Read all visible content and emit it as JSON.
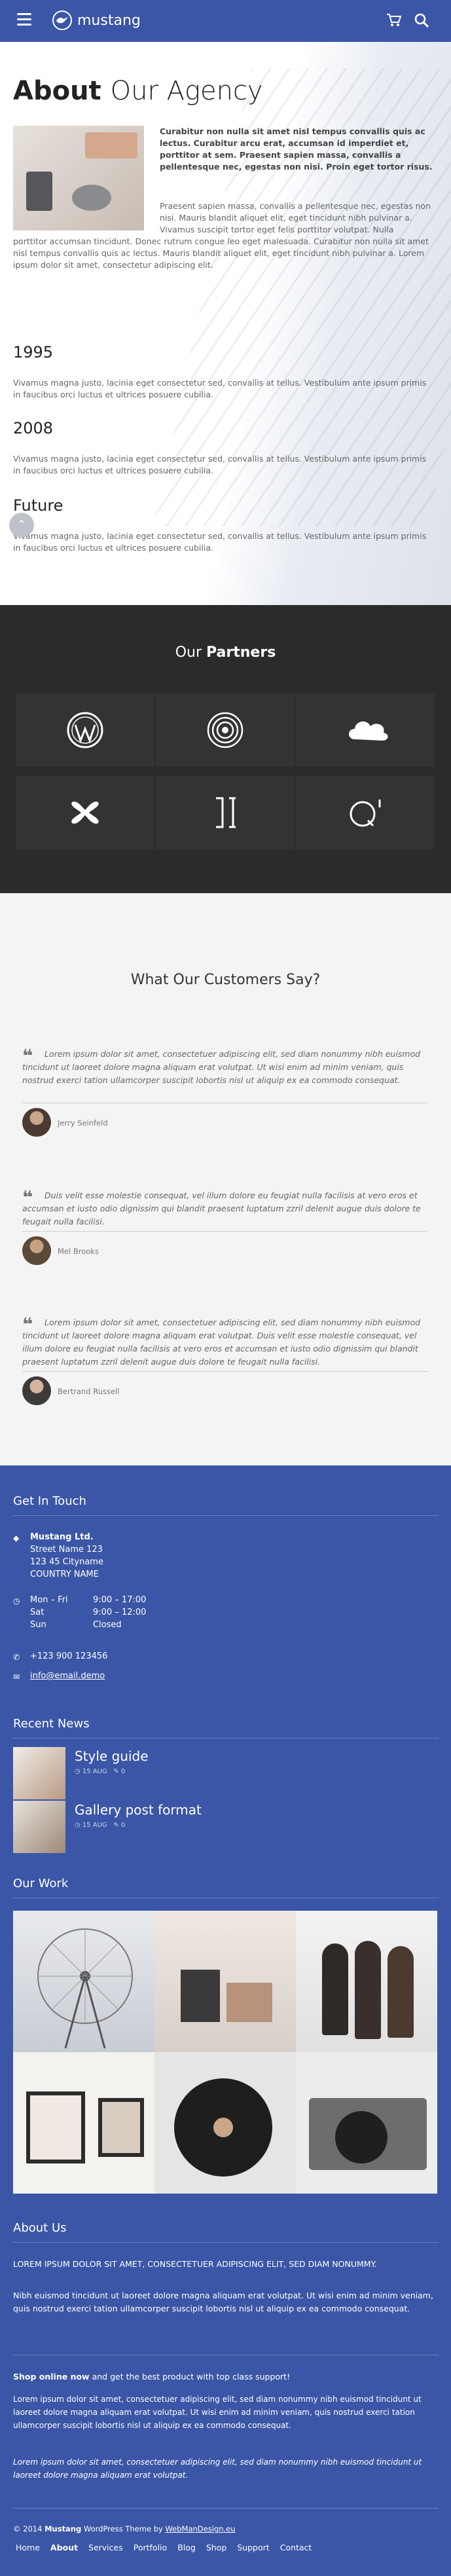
{
  "header": {
    "logo_text": "mustang",
    "icons": [
      "menu-icon",
      "cart-icon",
      "search-icon"
    ],
    "color": "#3b56a6"
  },
  "about": {
    "title_bold": "About",
    "title_thin": "Our Agency",
    "lead": "Curabitur non nulla sit amet nisl tempus convallis quis ac lectus. Curabitur arcu erat, accumsan id imperdiet et, porttitor at sem. Praesent sapien massa, convallis a pellentesque nec, egestas non nisi. Proin eget tortor risus.",
    "body_right": "Praesent sapien massa, convallis a pellentesque nec, egestas non nisi. Mauris blandit aliquet elit, eget tincidunt nibh pulvinar a. Vivamus suscipit tortor eget felis porttitor volutpat. Nulla",
    "body_full": "porttitor accumsan tincidunt. Donec rutrum congue leo eget malesuada. Curabitur non nulla sit amet nisl tempus convallis quis ac lectus. Mauris blandit aliquet elit, eget tincidunt nibh pulvinar a. Lorem ipsum dolor sit amet, consectetur adipiscing elit.",
    "timeline": [
      {
        "year": "1995",
        "text": "Vivamus magna justo, lacinia eget consectetur sed, convallis at tellus. Vestibulum ante ipsum primis in faucibus orci luctus et ultrices posuere cubilia."
      },
      {
        "year": "2008",
        "text": "Vivamus magna justo, lacinia eget consectetur sed, convallis at tellus. Vestibulum ante ipsum primis in faucibus orci luctus et ultrices posuere cubilia."
      },
      {
        "year": "Future",
        "text": "Vivamus magna justo, lacinia eget consectetur sed, convallis at tellus. Vestibulum ante ipsum primis in faucibus orci luctus et ultrices posuere cubilia."
      }
    ]
  },
  "partners": {
    "title_thin": "Our",
    "title_bold": "Partners",
    "logos": [
      "wordpress-icon",
      "spiral-icon",
      "cloud-icon",
      "cross-icon",
      "brackets-icon",
      "q-icon"
    ]
  },
  "testimonials": {
    "title": "What Our Customers Say?",
    "items": [
      {
        "quote": "Lorem ipsum dolor sit amet, consectetuer adipiscing elit, sed diam nonummy nibh euismod tincidunt ut laoreet dolore magna aliquam erat volutpat. Ut wisi enim ad minim veniam, quis nostrud exerci tation ullamcorper suscipit lobortis nisl ut aliquip ex ea commodo consequat.",
        "name": "Jerry Seinfeld"
      },
      {
        "quote": "Duis velit esse molestie consequat, vel illum dolore eu feugiat nulla facilisis at vero eros et accumsan et iusto odio dignissim qui blandit praesent luptatum zzril delenit augue duis dolore te feugait nulla facilisi.",
        "name": "Mel Brooks"
      },
      {
        "quote": "Lorem ipsum dolor sit amet, consectetuer adipiscing elit, sed diam nonummy nibh euismod tincidunt ut laoreet dolore magna aliquam erat volutpat. Duis velit esse molestie consequat, vel illum dolore eu feugiat nulla facilisis at vero eros et accumsan et iusto odio dignissim qui blandit praesent luptatum zzril delenit augue duis dolore te feugait nulla facilisi.",
        "name": "Bertrand Russell"
      }
    ]
  },
  "footer": {
    "get_in_touch": "Get In Touch",
    "company": "Mustang Ltd.",
    "address": [
      "Street Name 123",
      "123 45 Cityname",
      "COUNTRY NAME"
    ],
    "hours": [
      {
        "day": "Mon – Fri",
        "time": "9:00 – 17:00"
      },
      {
        "day": "Sat",
        "time": "9:00 – 12:00"
      },
      {
        "day": "Sun",
        "time": "Closed"
      }
    ],
    "phone": "+123 900 123456",
    "email": "info@email.demo",
    "recent_news": "Recent News",
    "news": [
      {
        "title": "Style guide",
        "date": "15 AUG",
        "comments": "0"
      },
      {
        "title": "Gallery post format",
        "date": "15 AUG",
        "comments": "0"
      }
    ],
    "our_work": "Our Work",
    "about_us": "About Us",
    "about_caps": "LOREM IPSUM DOLOR SIT AMET, CONSECTETUER ADIPISCING ELIT, SED DIAM NONUMMY.",
    "about_text": "Nibh euismod tincidunt ut laoreet dolore magna aliquam erat volutpat. Ut wisi enim ad minim veniam, quis nostrud exerci tation ullamcorper suscipit lobortis nisl ut aliquip ex ea commodo consequat.",
    "shop_bold": "Shop online now",
    "shop_rest": " and get the best product with top class support!",
    "shop_text": "Lorem ipsum dolor sit amet, consectetuer adipiscing elit, sed diam nonummy nibh euismod tincidunt ut laoreet dolore magna aliquam erat volutpat. Ut wisi enim ad minim veniam, quis nostrud exerci tation ullamcorper suscipit lobortis nisl ut aliquip ex ea commodo consequat.",
    "italic_text": "Lorem ipsum dolor sit amet, consectetuer adipiscing elit, sed diam nonummy nibh euismod tincidunt ut laoreet dolore magna aliquam erat volutpat.",
    "copyright_pre": "© 2014 ",
    "copyright_brand": "Mustang",
    "copyright_mid": " WordPress Theme by ",
    "copyright_author": "WebManDesign.eu",
    "nav": [
      "Home",
      "About",
      "Services",
      "Portfolio",
      "Blog",
      "Shop",
      "Support",
      "Contact"
    ],
    "nav_active": "About"
  }
}
